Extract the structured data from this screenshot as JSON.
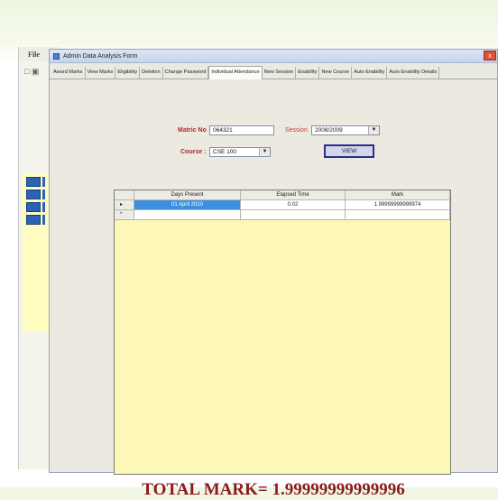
{
  "background_app": {
    "menu_label": "File"
  },
  "window": {
    "title": "Admin Data Analysis Form",
    "close_label": "x",
    "tabs": [
      "Award Marks",
      "View Marks",
      "Eligibility",
      "Deletion",
      "Change Password",
      "Individual Attendance",
      "New Session",
      "Enability",
      "New Course",
      "Auto Enability",
      "Auto Enability Details"
    ],
    "active_tab": "Individual Attendance"
  },
  "form": {
    "matric_label": "Matric No",
    "matric_value": "064321",
    "session_label": "Session",
    "session_value": "2008/2009",
    "course_label": "Course :",
    "course_value": "CSE 100",
    "view_button": "VIEW"
  },
  "grid": {
    "columns": [
      "Days Present",
      "Elapsed Time",
      "Mark"
    ],
    "rows": [
      {
        "indicator": "▸",
        "cells": [
          "01 April 2010",
          "0.02",
          "1.99999999999974"
        ]
      },
      {
        "indicator": "*",
        "cells": [
          "",
          "",
          ""
        ]
      }
    ]
  },
  "total_mark": "TOTAL MARK= 1.99999999999996",
  "colors": {
    "grid_background": "#fdf8b6",
    "selection": "#3b8fe0",
    "total_text": "#8b1a1f"
  }
}
